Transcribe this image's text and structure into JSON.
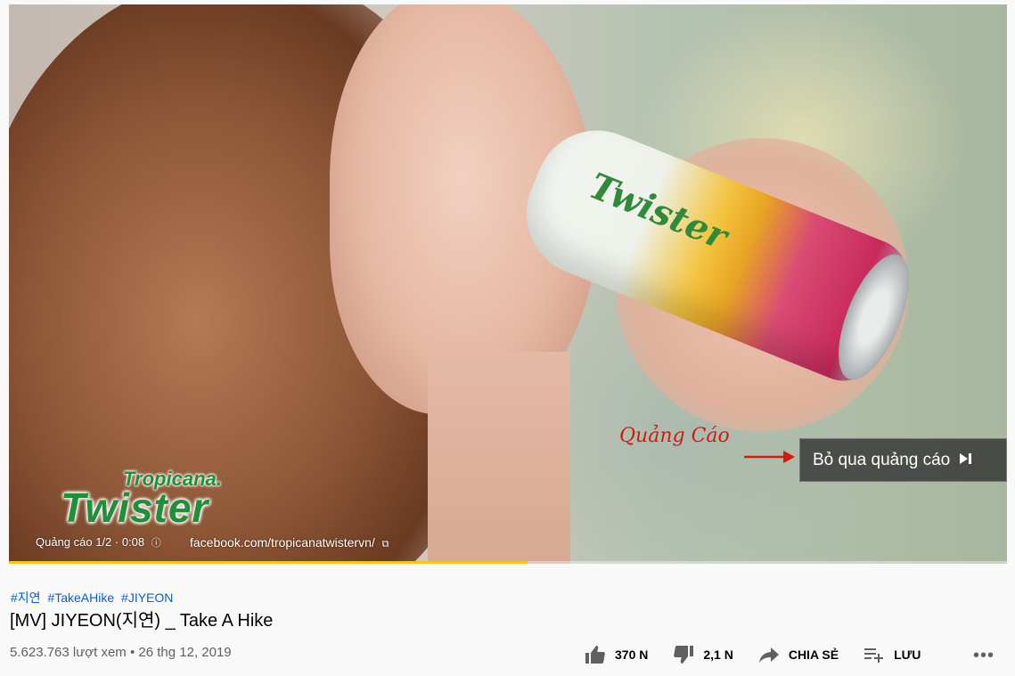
{
  "ad": {
    "brand_top": "Tropicana.",
    "brand_bottom": "Twister",
    "can_label": "Twister",
    "ad_info": "Quảng cáo 1/2 · 0:08",
    "ad_link": "facebook.com/tropicanatwistervn/",
    "skip_label": "Bỏ qua quảng cáo",
    "progress_fraction": 0.52,
    "annotation_label": "Quảng Cáo",
    "annotation_color": "#d21c12",
    "progress_color": "#f8c51c"
  },
  "video": {
    "hashtags": [
      "#지연",
      "#TakeAHike",
      "#JIYEON"
    ],
    "title": "[MV] JIYEON(지연) _ Take A Hike",
    "views": "5.623.763 lượt xem",
    "separator": "•",
    "date": "26 thg 12, 2019"
  },
  "actions": {
    "like_count": "370 N",
    "dislike_count": "2,1 N",
    "share_label": "CHIA SẺ",
    "save_label": "LƯU",
    "more_label": "•••"
  }
}
